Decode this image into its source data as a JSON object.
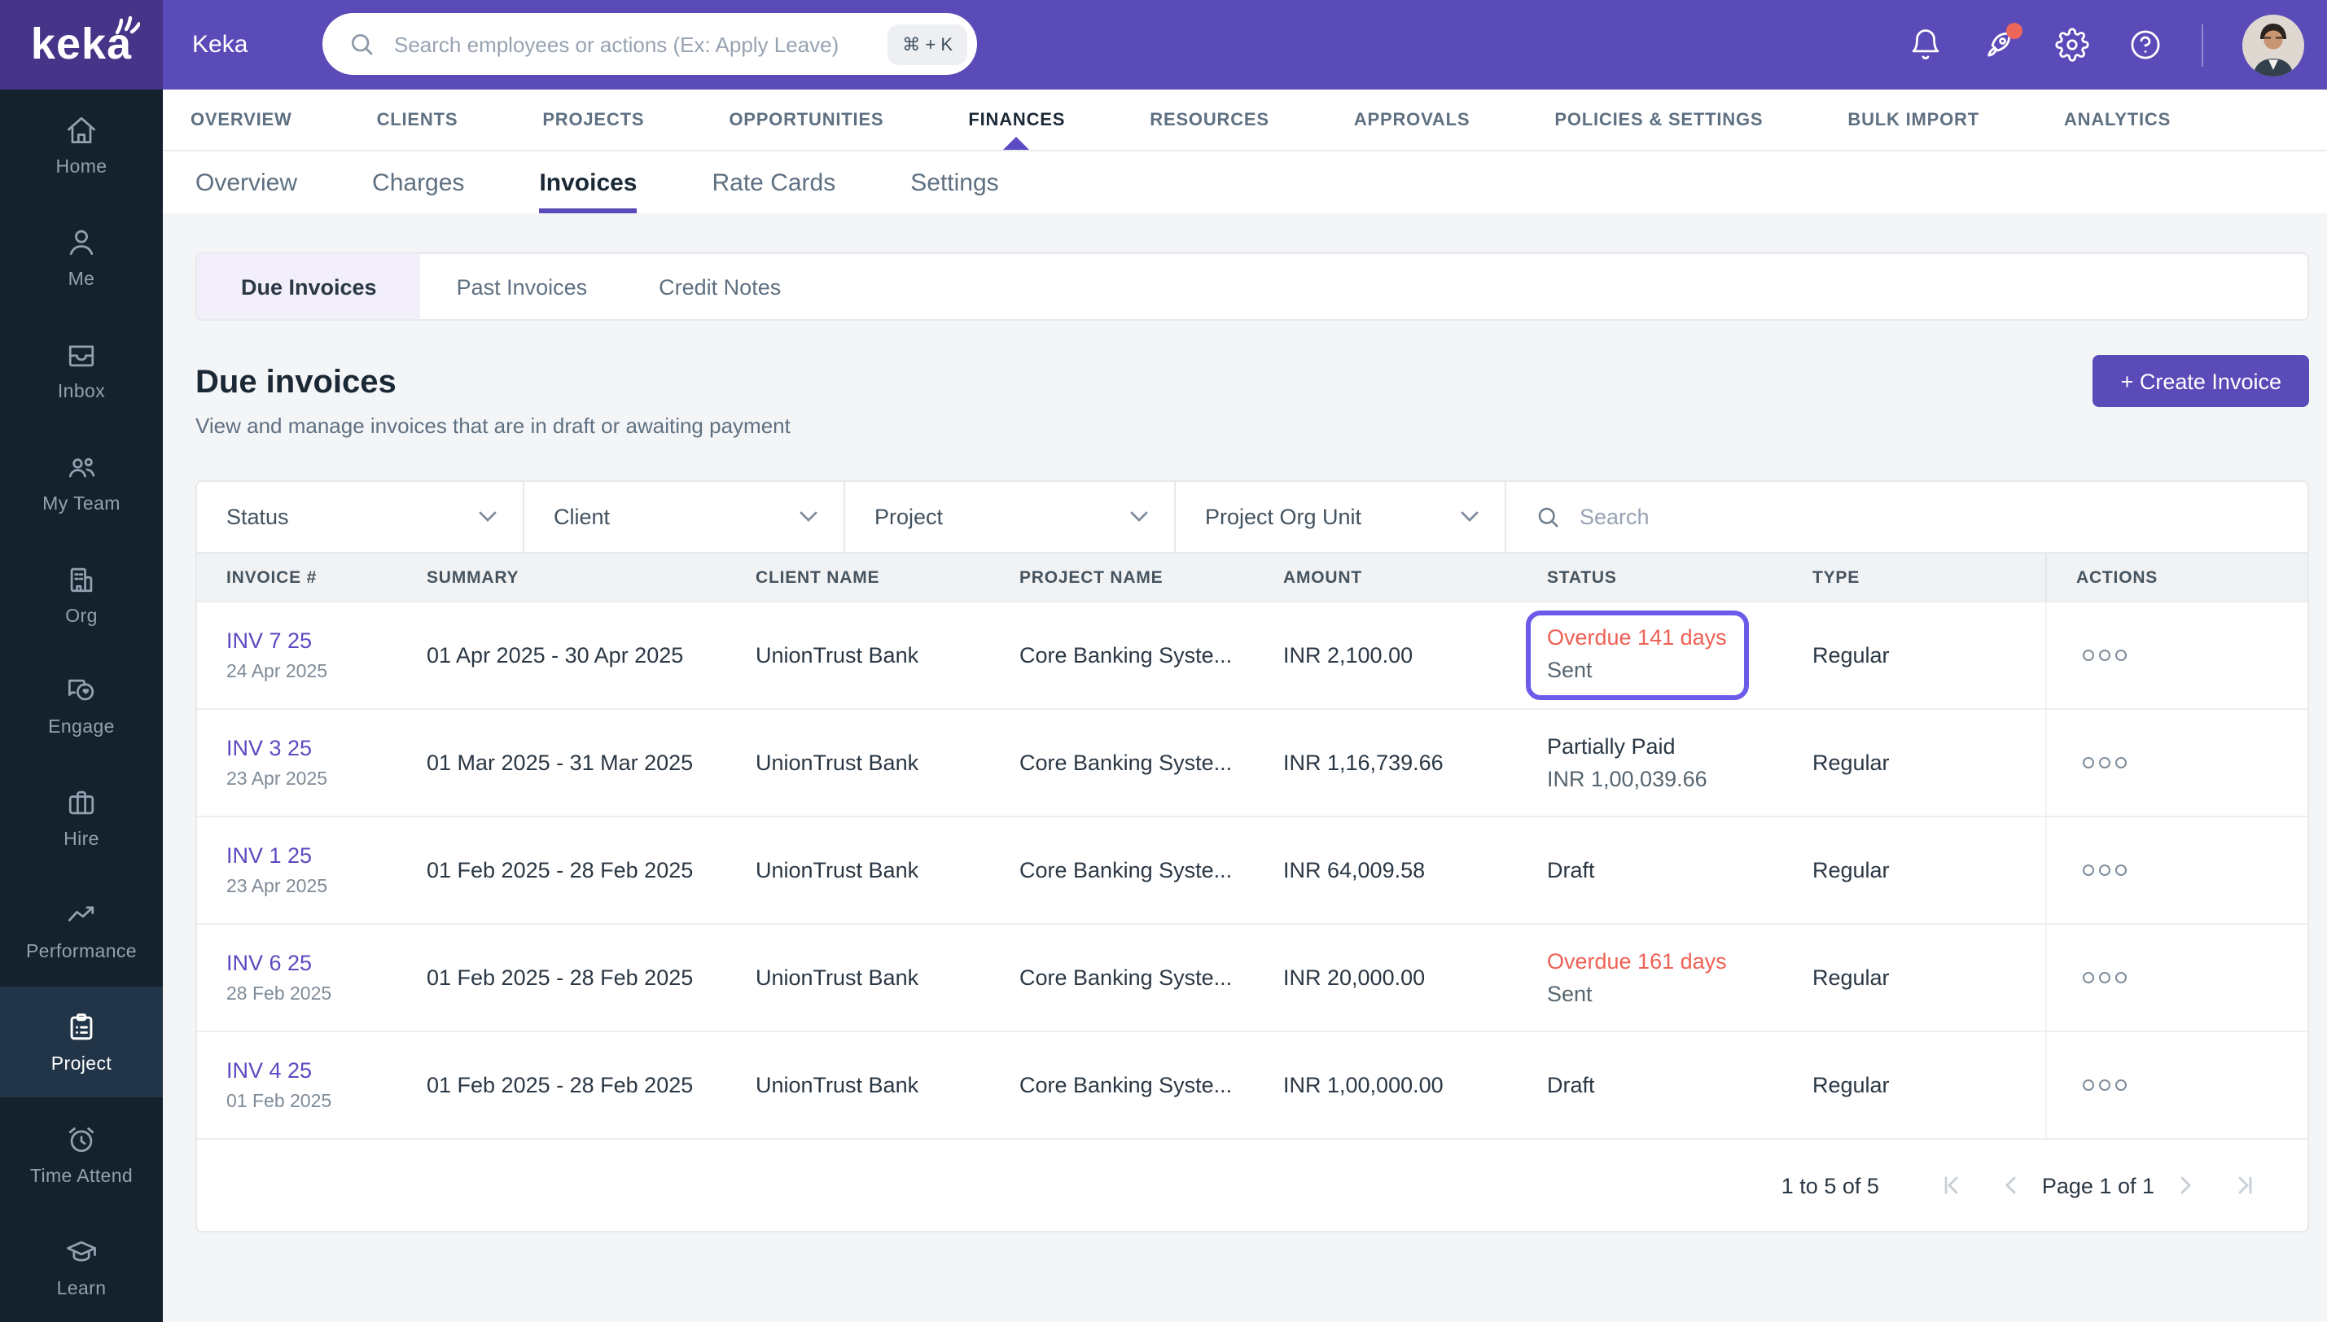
{
  "brand": {
    "logo_text": "keka",
    "app_title": "Keka"
  },
  "topbar": {
    "search_placeholder": "Search employees or actions (Ex: Apply Leave)",
    "shortcut_badge": "⌘ + K",
    "icons": [
      "bell-icon",
      "rocket-icon",
      "gear-icon",
      "help-icon",
      "avatar"
    ]
  },
  "sidebar": {
    "items": [
      {
        "label": "Home",
        "icon": "home-icon",
        "active": false
      },
      {
        "label": "Me",
        "icon": "person-icon",
        "active": false
      },
      {
        "label": "Inbox",
        "icon": "inbox-icon",
        "active": false
      },
      {
        "label": "My Team",
        "icon": "people-icon",
        "active": false
      },
      {
        "label": "Org",
        "icon": "building-icon",
        "active": false
      },
      {
        "label": "Engage",
        "icon": "chat-heart-icon",
        "active": false
      },
      {
        "label": "Hire",
        "icon": "briefcase-icon",
        "active": false
      },
      {
        "label": "Performance",
        "icon": "trend-icon",
        "active": false
      },
      {
        "label": "Project",
        "icon": "clipboard-icon",
        "active": true
      },
      {
        "label": "Time Attend",
        "icon": "alarm-icon",
        "active": false
      },
      {
        "label": "Learn",
        "icon": "grad-cap-icon",
        "active": false
      }
    ]
  },
  "main_nav": {
    "items": [
      {
        "label": "OVERVIEW",
        "active": false
      },
      {
        "label": "CLIENTS",
        "active": false
      },
      {
        "label": "PROJECTS",
        "active": false
      },
      {
        "label": "OPPORTUNITIES",
        "active": false
      },
      {
        "label": "FINANCES",
        "active": true
      },
      {
        "label": "RESOURCES",
        "active": false
      },
      {
        "label": "APPROVALS",
        "active": false
      },
      {
        "label": "POLICIES & SETTINGS",
        "active": false
      },
      {
        "label": "BULK IMPORT",
        "active": false
      },
      {
        "label": "ANALYTICS",
        "active": false
      }
    ]
  },
  "sub_nav": {
    "items": [
      {
        "label": "Overview",
        "active": false
      },
      {
        "label": "Charges",
        "active": false
      },
      {
        "label": "Invoices",
        "active": true
      },
      {
        "label": "Rate Cards",
        "active": false
      },
      {
        "label": "Settings",
        "active": false
      }
    ]
  },
  "invoice_tabs": {
    "items": [
      {
        "label": "Due Invoices",
        "active": true
      },
      {
        "label": "Past Invoices",
        "active": false
      },
      {
        "label": "Credit Notes",
        "active": false
      }
    ]
  },
  "page": {
    "title": "Due invoices",
    "subtitle": "View and manage invoices that are in draft or awaiting payment",
    "create_button": "+ Create Invoice"
  },
  "filters": {
    "dropdowns": [
      "Status",
      "Client",
      "Project",
      "Project Org Unit"
    ],
    "search_placeholder": "Search"
  },
  "table": {
    "headers": [
      "INVOICE #",
      "SUMMARY",
      "CLIENT NAME",
      "PROJECT NAME",
      "AMOUNT",
      "STATUS",
      "TYPE",
      "ACTIONS"
    ],
    "rows": [
      {
        "invoice_no": "INV 7 25",
        "invoice_date": "24 Apr 2025",
        "summary": "01 Apr 2025 - 30 Apr 2025",
        "client": "UnionTrust Bank",
        "project": "Core Banking Syste...",
        "amount": "INR 2,100.00",
        "status_primary": "Overdue 141 days",
        "status_secondary": "Sent",
        "status_primary_color": "#EE6055",
        "highlighted": true,
        "type": "Regular"
      },
      {
        "invoice_no": "INV 3 25",
        "invoice_date": "23 Apr 2025",
        "summary": "01 Mar 2025 - 31 Mar 2025",
        "client": "UnionTrust Bank",
        "project": "Core Banking Syste...",
        "amount": "INR 1,16,739.66",
        "status_primary": "Partially Paid",
        "status_secondary": "INR 1,00,039.66",
        "status_primary_color": "#2A3744",
        "highlighted": false,
        "type": "Regular"
      },
      {
        "invoice_no": "INV 1 25",
        "invoice_date": "23 Apr 2025",
        "summary": "01 Feb 2025 - 28 Feb 2025",
        "client": "UnionTrust Bank",
        "project": "Core Banking Syste...",
        "amount": "INR 64,009.58",
        "status_primary": "Draft",
        "status_secondary": "",
        "status_primary_color": "#2A3744",
        "highlighted": false,
        "type": "Regular"
      },
      {
        "invoice_no": "INV 6 25",
        "invoice_date": "28 Feb 2025",
        "summary": "01 Feb 2025 - 28 Feb 2025",
        "client": "UnionTrust Bank",
        "project": "Core Banking Syste...",
        "amount": "INR 20,000.00",
        "status_primary": "Overdue 161 days",
        "status_secondary": "Sent",
        "status_primary_color": "#EE6055",
        "highlighted": false,
        "type": "Regular"
      },
      {
        "invoice_no": "INV 4 25",
        "invoice_date": "01 Feb 2025",
        "summary": "01 Feb 2025 - 28 Feb 2025",
        "client": "UnionTrust Bank",
        "project": "Core Banking Syste...",
        "amount": "INR 1,00,000.00",
        "status_primary": "Draft",
        "status_secondary": "",
        "status_primary_color": "#2A3744",
        "highlighted": false,
        "type": "Regular"
      }
    ]
  },
  "pagination": {
    "range": "1 to 5 of 5",
    "page_label": "Page 1 of 1"
  },
  "theme": {
    "header_purple": "#5A4BB8",
    "logo_purple": "#453488",
    "sidebar_navy": "#15222E",
    "sidebar_active": "#223548",
    "accent_purple": "#5B4AC0",
    "highlight_border": "#6C5BE8",
    "overdue_red": "#EE6055",
    "notification_red": "#EC6759",
    "page_bg": "#F4F5F7"
  }
}
